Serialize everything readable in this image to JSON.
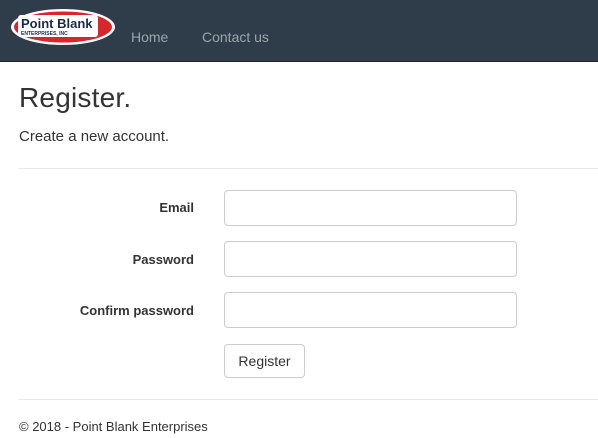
{
  "brand": {
    "name": "Point Blank",
    "tagline": "ENTERPRISES, INC"
  },
  "nav": {
    "items": [
      {
        "label": "Home"
      },
      {
        "label": "Contact us"
      }
    ]
  },
  "page": {
    "title": "Register.",
    "subtitle": "Create a new account."
  },
  "form": {
    "email_label": "Email",
    "email_value": "",
    "password_label": "Password",
    "password_value": "",
    "confirm_label": "Confirm password",
    "confirm_value": "",
    "submit_label": "Register"
  },
  "footer": {
    "text": "© 2018 - Point Blank Enterprises"
  },
  "colors": {
    "navbar": "#2f3d4a",
    "logo_red": "#d9262c",
    "nav_link": "#9aa5ae"
  }
}
